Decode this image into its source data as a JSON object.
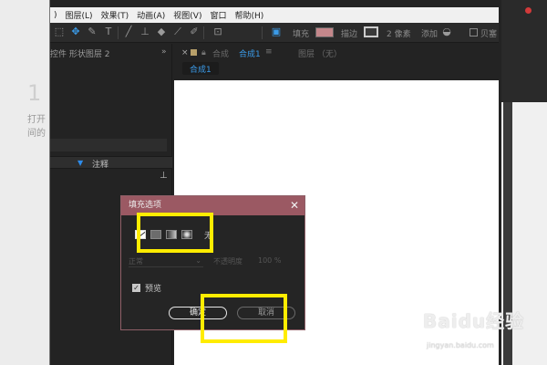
{
  "menu": [
    ")",
    "图层(L)",
    "效果(T)",
    "动画(A)",
    "视图(V)",
    "窗口",
    "帮助(H)"
  ],
  "toolbar": {
    "fill_label": "填充",
    "stroke_label": "描边",
    "stroke_width": "2 像素",
    "add_label": "添加",
    "checkbox_label": "贝塞",
    "tools": [
      "pointer-icon",
      "pen-icon",
      "text-icon",
      "brush-icon",
      "clone-stamp-icon",
      "eraser-icon",
      "roto-icon",
      "puppet-pin-icon"
    ]
  },
  "background_page": {
    "title_fragment": "1",
    "text_line1": "打开",
    "text_line2": "间的"
  },
  "left_panel": {
    "tab_label": "控件 形状图层 2",
    "collapse": "»",
    "section_label": "注释"
  },
  "comp_panel": {
    "close": "×",
    "tab_prefix": "合成",
    "tab_name": "合成1",
    "tab_menu": "≡",
    "layer_label": "图层 （无）",
    "sub_tab": "合成1"
  },
  "dialog": {
    "title": "填充选项",
    "close": "✕",
    "fill_types": [
      "none-fill-icon",
      "solid-fill-icon",
      "linear-gradient-icon",
      "radial-gradient-icon"
    ],
    "fill_none_label": "无",
    "mode_value": "正常",
    "opacity_label": "不透明度",
    "opacity_value": "100 %",
    "preview_label": "预览",
    "preview_checked": true,
    "ok_label": "确定",
    "cancel_label": "取消"
  },
  "watermark": {
    "logo": "Baidu经验",
    "url": "jingyan.baidu.com"
  },
  "colors": {
    "dialog_title_bar": "#9b5963",
    "highlight": "#ffec00",
    "accent_blue": "#3b9be8",
    "fill_swatch": "#c4878b"
  }
}
